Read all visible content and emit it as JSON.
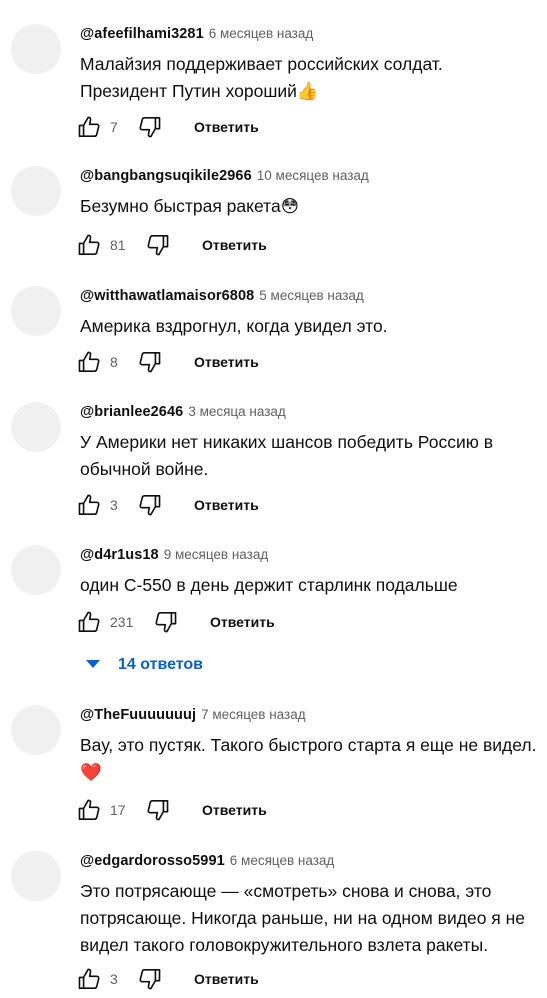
{
  "comments": [
    {
      "author": "@afeefilhami3281",
      "time": "6 месяцев назад",
      "text_lines": [
        "Малайзия поддерживает российских солдат.",
        "Президент Путин хороший👍"
      ],
      "likes": "7",
      "reply_label": "Ответить"
    },
    {
      "author": "@bangbangsuqikile2966",
      "time": "10 месяцев назад",
      "text_lines": [
        "Безумно быстрая ракета😳"
      ],
      "likes": "81",
      "reply_label": "Ответить"
    },
    {
      "author": "@witthawatlamaisor6808",
      "time": "5 месяцев назад",
      "text_lines": [
        "Америка вздрогнул, когда увидел это."
      ],
      "likes": "8",
      "reply_label": "Ответить"
    },
    {
      "author": "@brianlee2646",
      "time": "3 месяца назад",
      "text_lines": [
        "У Америки нет никаких шансов победить Россию в",
        "обычной войне."
      ],
      "likes": "3",
      "reply_label": "Ответить"
    },
    {
      "author": "@d4r1us18",
      "time": "9 месяцев назад",
      "text_lines": [
        "один С-550 в день держит старлинк подальше"
      ],
      "likes": "231",
      "reply_label": "Ответить",
      "replies_label": "14 ответов"
    },
    {
      "author": "@TheFuuuuuuuj",
      "time": "7 месяцев назад",
      "text_lines": [
        "Вау, это пустяк. Такого быстрого старта я еще не видел.",
        "❤️"
      ],
      "likes": "17",
      "reply_label": "Ответить"
    },
    {
      "author": "@edgardorosso5991",
      "time": "6 месяцев назад",
      "text_lines": [
        "Это потрясающе — «смотреть» снова и снова, это",
        "потрясающе. Никогда раньше, ни на одном видео я не",
        "видел такого головокружительного взлета ракеты."
      ],
      "likes": "3",
      "reply_label": "Ответить"
    }
  ],
  "icons": {
    "like": "thumbs-up-icon",
    "dislike": "thumbs-down-icon",
    "replies_toggle": "caret-down-icon"
  },
  "colors": {
    "link_blue": "#065fd4",
    "secondary_text": "#606060",
    "avatar_placeholder": "#f0f0f0"
  }
}
